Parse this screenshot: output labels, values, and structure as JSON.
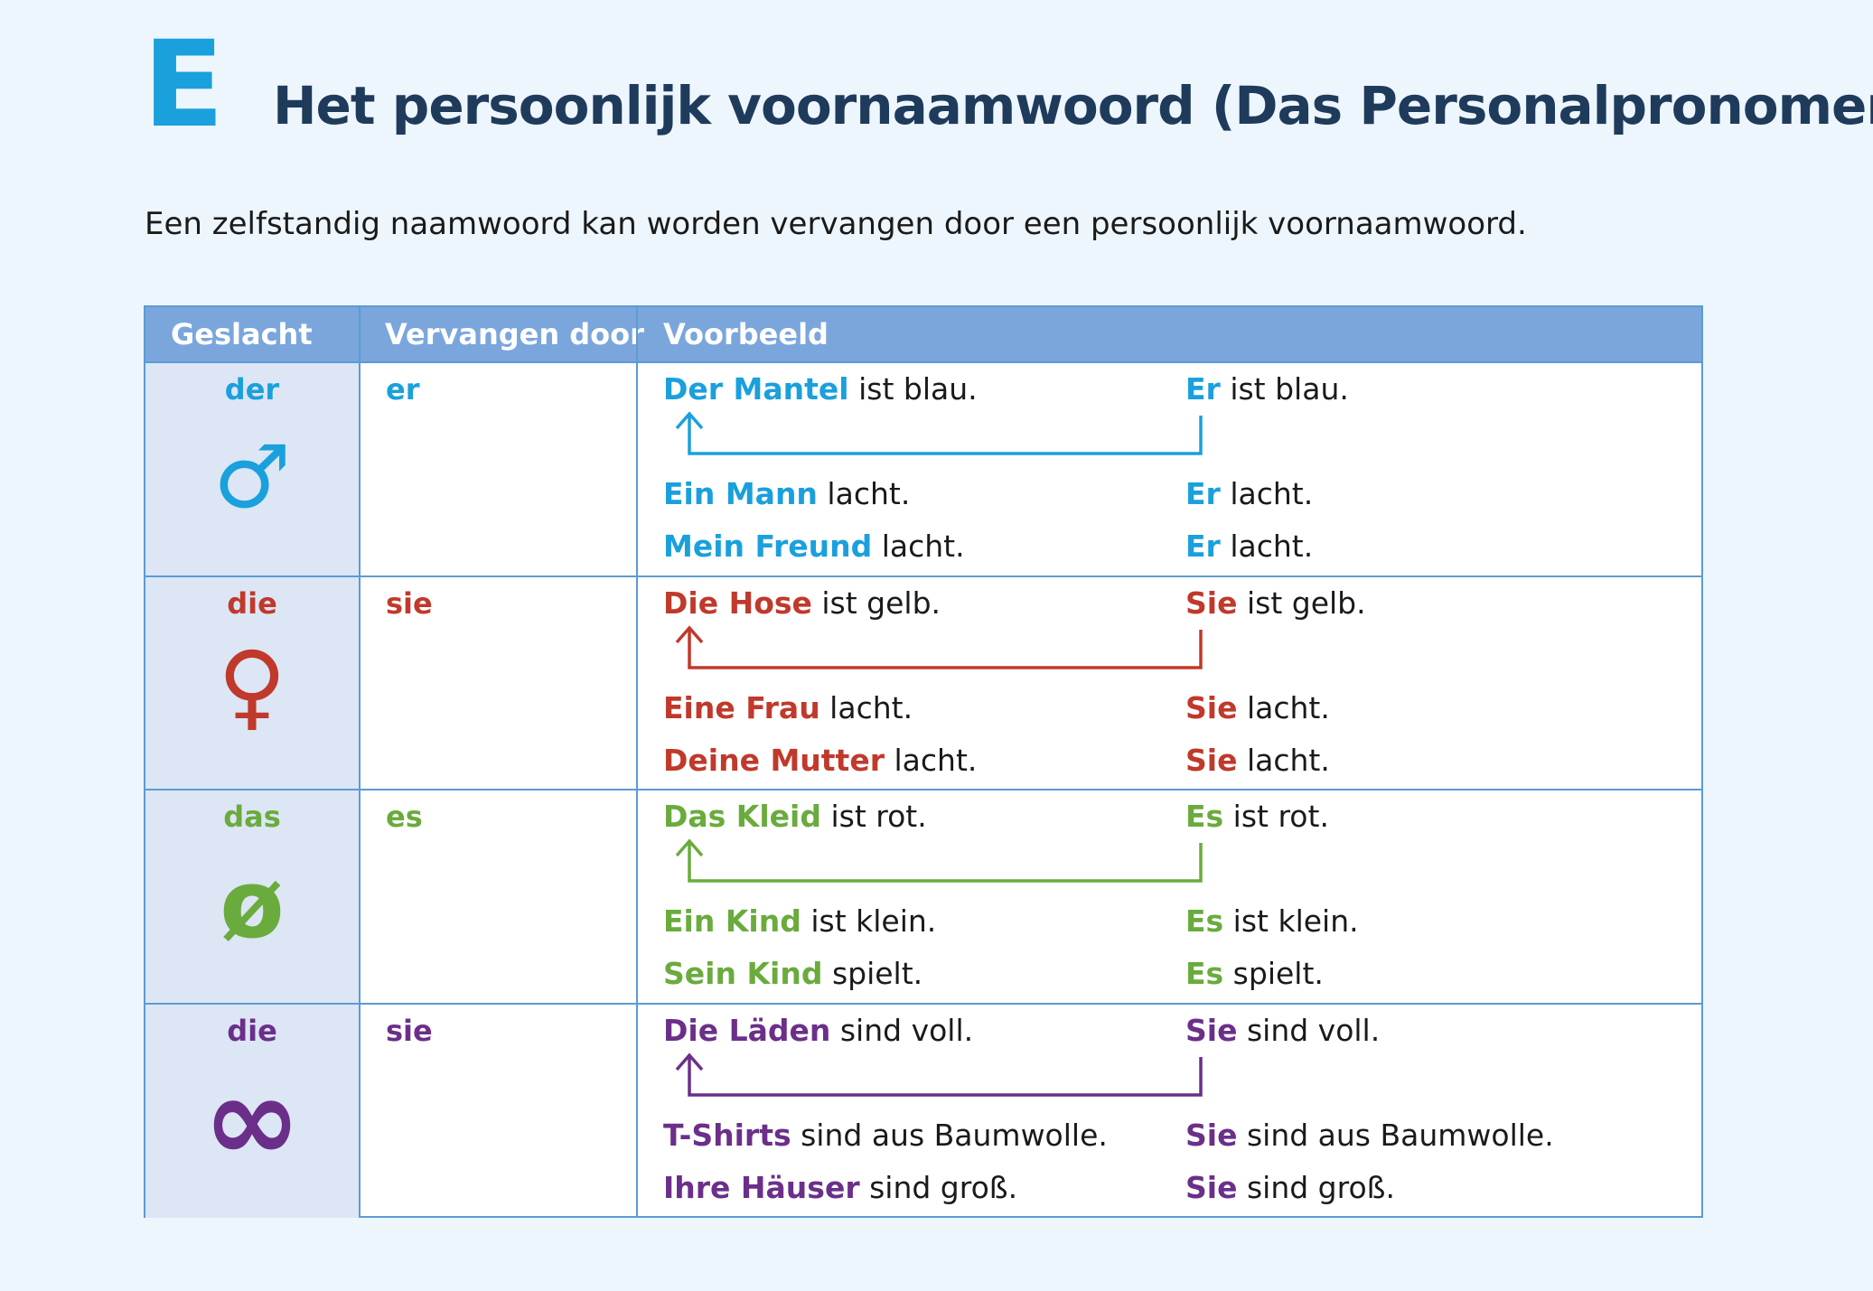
{
  "section_letter": "E",
  "title": "Het persoonlijk voornaamwoord (Das Personalpronomen)",
  "intro": "Een zelfstandig naamwoord kan worden vervangen door een persoonlijk voornaamwoord.",
  "table": {
    "headers": [
      "Geslacht",
      "Vervangen door",
      "Voorbeeld"
    ],
    "rows": [
      {
        "article": "der",
        "symbol": "♂",
        "symbol_icon": "male-icon",
        "pronoun": "er",
        "color": "#1aa0dc",
        "examples": [
          {
            "noun": "Der Mantel",
            "rest": " ist blau.",
            "pron": "Er",
            "prest": " ist blau."
          },
          {
            "noun": "Ein Mann",
            "rest": " lacht.",
            "pron": "Er",
            "prest": " lacht."
          },
          {
            "noun": "Mein Freund",
            "rest": " lacht.",
            "pron": "Er",
            "prest": " lacht."
          }
        ]
      },
      {
        "article": "die",
        "symbol": "♀",
        "symbol_icon": "female-icon",
        "pronoun": "sie",
        "color": "#c0392b",
        "examples": [
          {
            "noun": "Die Hose",
            "rest": " ist gelb.",
            "pron": "Sie",
            "prest": " ist gelb."
          },
          {
            "noun": "Eine Frau",
            "rest": " lacht.",
            "pron": "Sie",
            "prest": " lacht."
          },
          {
            "noun": "Deine Mutter",
            "rest": " lacht.",
            "pron": "Sie",
            "prest": " lacht."
          }
        ]
      },
      {
        "article": "das",
        "symbol": "ø",
        "symbol_icon": "neuter-icon",
        "pronoun": "es",
        "color": "#6aab3d",
        "examples": [
          {
            "noun": "Das Kleid",
            "rest": " ist rot.",
            "pron": "Es",
            "prest": " ist rot."
          },
          {
            "noun": "Ein Kind",
            "rest": " ist klein.",
            "pron": "Es",
            "prest": " ist klein."
          },
          {
            "noun": "Sein Kind",
            "rest": " spielt.",
            "pron": "Es",
            "prest": " spielt."
          }
        ]
      },
      {
        "article": "die",
        "symbol": "∞",
        "symbol_icon": "infinity-icon",
        "pronoun": "sie",
        "color": "#6b2f8a",
        "examples": [
          {
            "noun": "Die Läden",
            "rest": " sind voll.",
            "pron": "Sie",
            "prest": " sind voll."
          },
          {
            "noun": "T-Shirts",
            "rest": " sind aus Baumwolle.",
            "pron": "Sie",
            "prest": " sind aus Baumwolle."
          },
          {
            "noun": "Ihre Häuser",
            "rest": " sind groß.",
            "pron": "Sie",
            "prest": " sind groß."
          }
        ]
      }
    ]
  }
}
